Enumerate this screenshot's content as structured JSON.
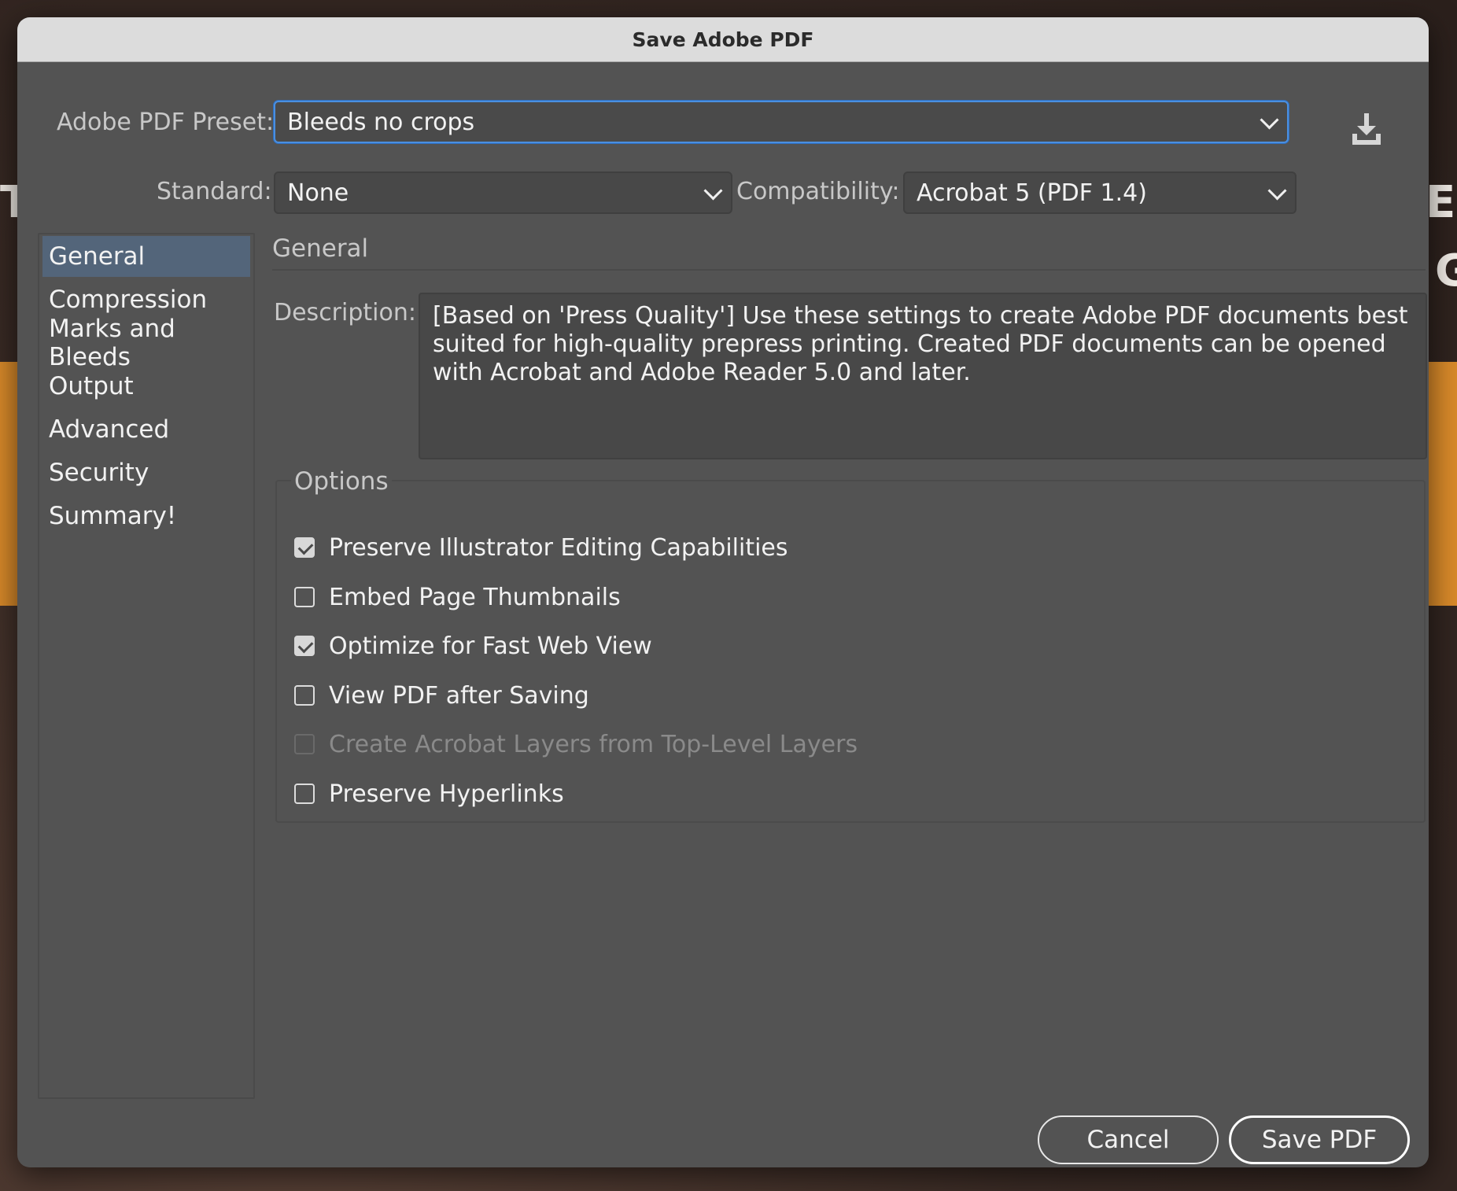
{
  "dialog": {
    "title": "Save Adobe PDF"
  },
  "preset": {
    "label": "Adobe PDF Preset:",
    "value": "Bleeds no crops",
    "save_icon": "download-icon"
  },
  "standard": {
    "label": "Standard:",
    "value": "None"
  },
  "compatibility": {
    "label": "Compatibility:",
    "value": "Acrobat 5 (PDF 1.4)"
  },
  "sidebar": {
    "items": [
      {
        "label": "General",
        "active": true
      },
      {
        "label": "Compression",
        "active": false
      },
      {
        "label": "Marks and Bleeds",
        "active": false
      },
      {
        "label": "Output",
        "active": false
      },
      {
        "label": "Advanced",
        "active": false
      },
      {
        "label": "Security",
        "active": false
      },
      {
        "label": "Summary!",
        "active": false
      }
    ]
  },
  "main": {
    "section_title": "General",
    "description_label": "Description:",
    "description": "[Based on 'Press Quality'] Use these settings to create Adobe PDF documents best suited for high-quality prepress printing.  Created PDF documents can be opened with Acrobat and Adobe Reader 5.0 and later.",
    "options_title": "Options",
    "options": [
      {
        "label": "Preserve Illustrator Editing Capabilities",
        "checked": true,
        "enabled": true
      },
      {
        "label": "Embed Page Thumbnails",
        "checked": false,
        "enabled": true
      },
      {
        "label": "Optimize for Fast Web View",
        "checked": true,
        "enabled": true
      },
      {
        "label": "View PDF after Saving",
        "checked": false,
        "enabled": true
      },
      {
        "label": "Create Acrobat Layers from Top-Level Layers",
        "checked": false,
        "enabled": false
      },
      {
        "label": "Preserve Hyperlinks",
        "checked": false,
        "enabled": true
      }
    ]
  },
  "buttons": {
    "cancel": "Cancel",
    "save": "Save PDF"
  },
  "colors": {
    "dialog_bg": "#535353",
    "focus": "#4a8fe0",
    "sidebar_active": "#53657a"
  }
}
